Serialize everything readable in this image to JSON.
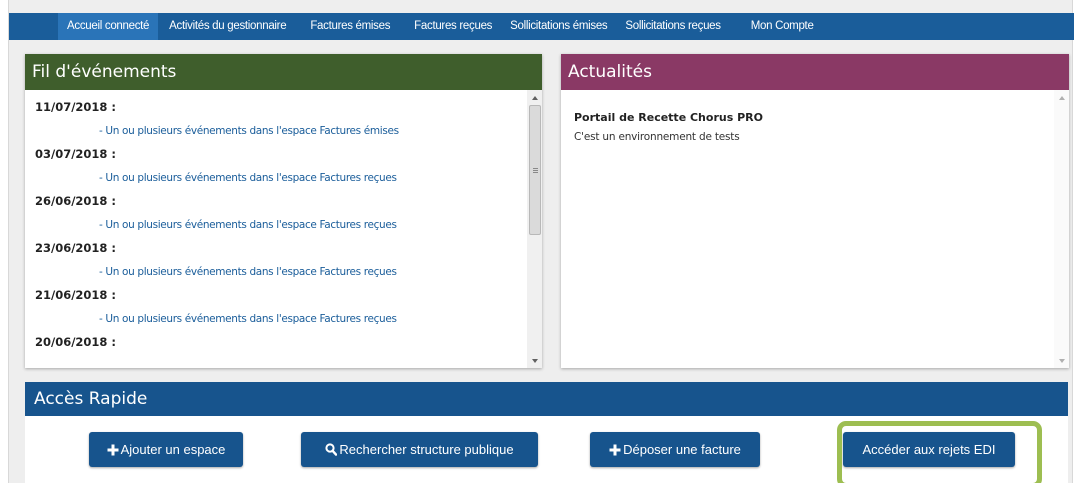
{
  "nav": {
    "items": [
      {
        "label": "Accueil connecté",
        "active": true
      },
      {
        "label": "Activités du gestionnaire",
        "active": false
      },
      {
        "label": "Factures émises",
        "active": false
      },
      {
        "label": "Factures reçues",
        "active": false
      },
      {
        "label": "Sollicitations émises",
        "active": false
      },
      {
        "label": "Sollicitations reçues",
        "active": false
      },
      {
        "label": "Mon Compte",
        "active": false
      }
    ]
  },
  "events_panel": {
    "title": "Fil d'événements",
    "header_color": "#3f5e2c",
    "events": [
      {
        "date": "11/07/2018 :",
        "text": "- Un ou plusieurs événements dans l'espace Factures émises"
      },
      {
        "date": "03/07/2018 :",
        "text": "- Un ou plusieurs événements dans l'espace Factures reçues"
      },
      {
        "date": "26/06/2018 :",
        "text": "- Un ou plusieurs événements dans l'espace Factures reçues"
      },
      {
        "date": "23/06/2018 :",
        "text": "- Un ou plusieurs événements dans l'espace Factures reçues"
      },
      {
        "date": "21/06/2018 :",
        "text": "- Un ou plusieurs événements dans l'espace Factures reçues"
      },
      {
        "date": "20/06/2018 :",
        "text": ""
      }
    ]
  },
  "news_panel": {
    "title": "Actualités",
    "header_color": "#8a3965",
    "news_title": "Portail de Recette Chorus PRO",
    "news_text": "C'est un environnement de tests"
  },
  "quick_access": {
    "title": "Accès Rapide",
    "buttons": [
      {
        "label": "Ajouter un espace",
        "icon": "plus-icon"
      },
      {
        "label": "Rechercher structure publique",
        "icon": "search-icon"
      },
      {
        "label": "Déposer une facture",
        "icon": "plus-icon"
      },
      {
        "label": "Accéder aux rejets EDI",
        "icon": ""
      }
    ]
  },
  "colors": {
    "nav_bg": "#1a5d9a",
    "button_bg": "#17548d",
    "highlight": "#9dbe51"
  }
}
